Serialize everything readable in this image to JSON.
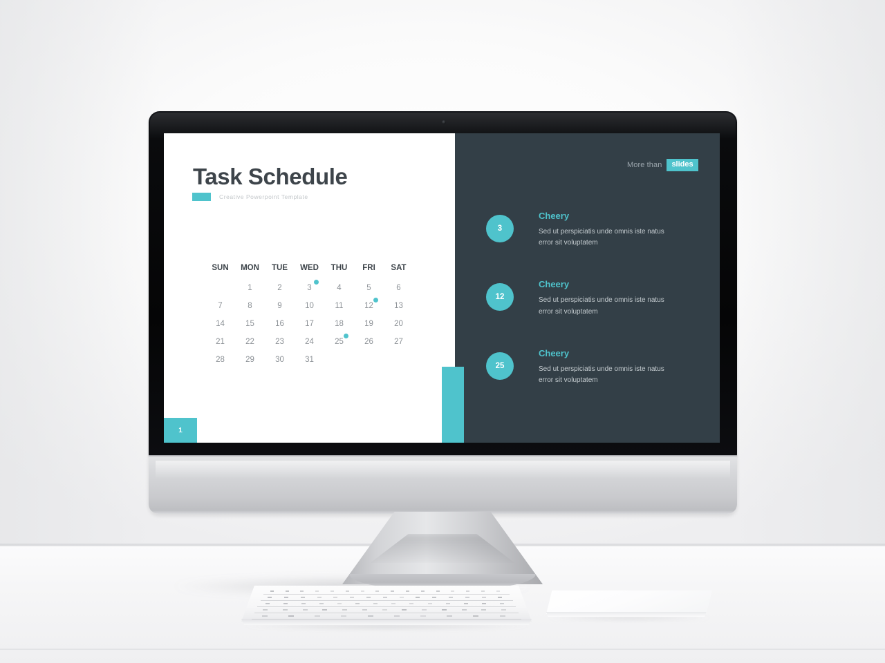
{
  "slide": {
    "title": "Task Schedule",
    "subtitle": "Creative Powerpoint Template",
    "page_number": "1",
    "header": {
      "more_than_label": "More than",
      "slides_badge": "slides"
    },
    "calendar": {
      "weekday_headers": [
        "SUN",
        "MON",
        "TUE",
        "WED",
        "THU",
        "FRI",
        "SAT"
      ],
      "weeks": [
        [
          "",
          "1",
          "2",
          "3",
          "4",
          "5",
          "6"
        ],
        [
          "7",
          "8",
          "9",
          "10",
          "11",
          "12",
          "13"
        ],
        [
          "14",
          "15",
          "16",
          "17",
          "18",
          "19",
          "20"
        ],
        [
          "21",
          "22",
          "23",
          "24",
          "25",
          "26",
          "27"
        ],
        [
          "28",
          "29",
          "30",
          "31",
          "",
          "",
          ""
        ]
      ],
      "marked_days": [
        "3",
        "12",
        "25"
      ]
    },
    "events": [
      {
        "day": "3",
        "title": "Cheery",
        "description": "Sed ut perspiciatis unde omnis iste natus error sit voluptatem"
      },
      {
        "day": "12",
        "title": "Cheery",
        "description": "Sed ut perspiciatis unde omnis iste natus error sit voluptatem"
      },
      {
        "day": "25",
        "title": "Cheery",
        "description": "Sed ut perspiciatis unde omnis iste natus error sit voluptatem"
      }
    ],
    "colors": {
      "accent_teal": "#4fc3cc",
      "panel_dark": "#333f47",
      "title_gray": "#3d444a",
      "body_gray": "#c5ccd0"
    }
  }
}
